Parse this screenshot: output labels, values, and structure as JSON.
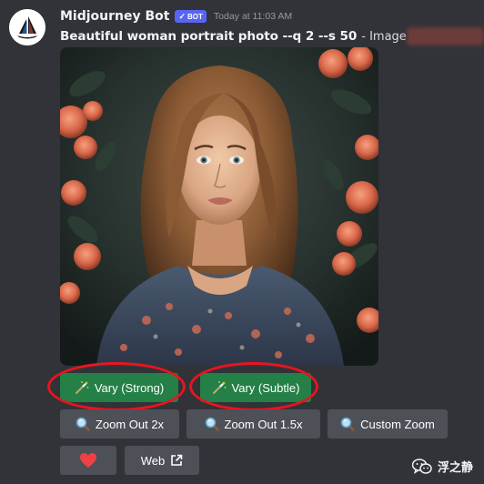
{
  "message": {
    "author": "Midjourney Bot",
    "bot_badge": "BOT",
    "badge_check": "✓",
    "timestamp": "Today at 11:03 AM",
    "prompt": "Beautiful woman portrait photo --q 2 --s 50",
    "image_label": "- Image #1"
  },
  "buttons": {
    "vary_strong": "Vary (Strong)",
    "vary_subtle": "Vary (Subtle)",
    "zoom_out_2x": "Zoom Out 2x",
    "zoom_out_1_5x": "Zoom Out 1.5x",
    "custom_zoom": "Custom Zoom",
    "web": "Web"
  },
  "icons": {
    "vary": "magic-wand-icon",
    "zoom": "magnifier-icon",
    "heart": "heart-icon",
    "external_link": "external-link-icon",
    "wechat": "wechat-icon"
  },
  "watermark": {
    "text": "浮之静"
  },
  "colors": {
    "background": "#313338",
    "green_button": "#248046",
    "grey_button": "#4e5058",
    "bot_badge": "#5865f2",
    "annotation": "#e8141f",
    "heart": "#f23f43"
  }
}
